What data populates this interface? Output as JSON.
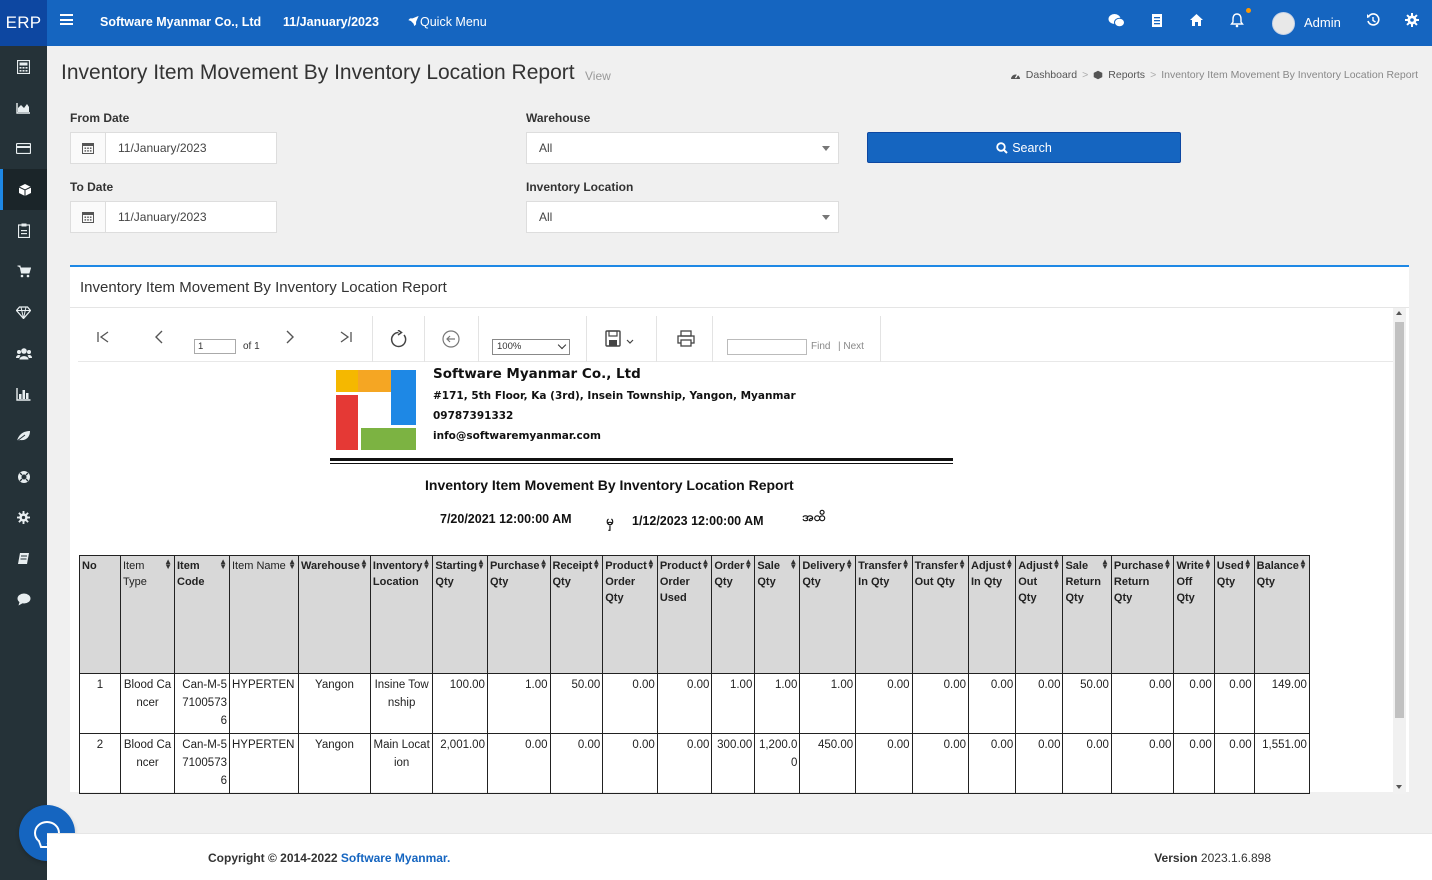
{
  "topbar": {
    "brand": "ERP",
    "company": "Software Myanmar Co., Ltd",
    "date": "11/January/2023",
    "quick_menu": "Quick Menu",
    "user": "Admin"
  },
  "page": {
    "title": "Inventory Item Movement By Inventory Location Report",
    "subtitle": "View",
    "breadcrumb": [
      "Dashboard",
      "Reports",
      "Inventory Item Movement By Inventory Location Report"
    ]
  },
  "form": {
    "from_date_label": "From Date",
    "from_date_value": "11/January/2023",
    "to_date_label": "To Date",
    "to_date_value": "11/January/2023",
    "warehouse_label": "Warehouse",
    "warehouse_value": "All",
    "location_label": "Inventory Location",
    "location_value": "All",
    "search_label": "Search"
  },
  "panel": {
    "title": "Inventory Item Movement By Inventory Location Report"
  },
  "viewer": {
    "page_value": "1",
    "of_pages": "of 1",
    "zoom": "100%",
    "find_label": "Find",
    "next_label": "| Next"
  },
  "report": {
    "company_name": "Software Myanmar Co., Ltd",
    "address": "#171, 5th Floor, Ka (3rd), Insein Township, Yangon, Myanmar",
    "phone": "09787391332",
    "email": "info@softwaremyanmar.com",
    "title": "Inventory Item Movement By Inventory Location Report",
    "from_datetime": "7/20/2021 12:00:00 AM",
    "separator": "မှ",
    "to_datetime": "1/12/2023 12:00:00 AM",
    "to_suffix": "အထိ",
    "columns": [
      "No",
      "Item Type",
      "Item Code",
      "Item Name",
      "Warehouse",
      "Inventory Location",
      "Starting Qty",
      "Purchase Qty",
      "Receipt Qty",
      "Product Order Qty",
      "Product Order Used",
      "Order Qty",
      "Sale Qty",
      "Delivery Qty",
      "Transfer In Qty",
      "Transfer Out Qty",
      "Adjust In Qty",
      "Adjust Out Qty",
      "Sale Return Qty",
      "Purchase Return Qty",
      "Write Off Qty",
      "Used Qty",
      "Balance Qty"
    ],
    "rows": [
      [
        "1",
        "Blood Cancer",
        "Can-M-571005736",
        "HYPERTEN",
        "Yangon",
        "Insine Township",
        "100.00",
        "1.00",
        "50.00",
        "0.00",
        "0.00",
        "1.00",
        "1.00",
        "1.00",
        "0.00",
        "0.00",
        "0.00",
        "0.00",
        "50.00",
        "0.00",
        "0.00",
        "0.00",
        "149.00"
      ],
      [
        "2",
        "Blood Cancer",
        "Can-M-571005736",
        "HYPERTEN",
        "Yangon",
        "Main Location",
        "2,001.00",
        "0.00",
        "0.00",
        "0.00",
        "0.00",
        "300.00",
        "1,200.00",
        "450.00",
        "0.00",
        "0.00",
        "0.00",
        "0.00",
        "0.00",
        "0.00",
        "0.00",
        "0.00",
        "1,551.00"
      ]
    ]
  },
  "footer": {
    "copyright_prefix": "Copyright © 2014-2022",
    "copyright_link": "Software Myanmar.",
    "version_label": "Version",
    "version_value": "2023.1.6.898"
  },
  "colors": {
    "topbar": "#1565c0",
    "sidebar": "#253238",
    "accent": "#1e88e5"
  },
  "icons": {
    "sidebar": [
      "calculator-icon",
      "area-chart-icon",
      "credit-card-icon",
      "cube-icon",
      "clipboard-icon",
      "cart-icon",
      "diamond-icon",
      "users-icon",
      "bar-chart-icon",
      "leaf-icon",
      "life-ring-icon",
      "gear-icon",
      "book-icon",
      "comment-icon"
    ]
  }
}
